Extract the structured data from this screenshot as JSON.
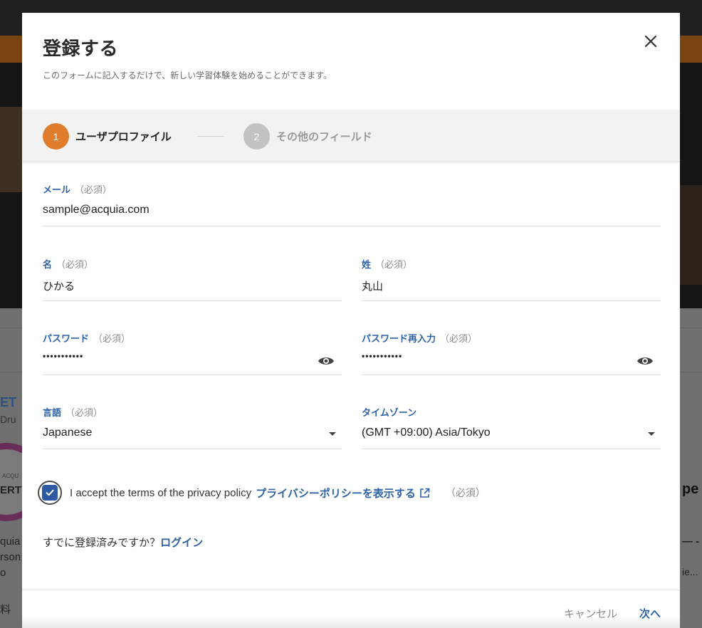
{
  "background": {
    "left_snippets": [
      "ET",
      "Dru",
      "ACQU",
      "ERTI",
      "quia",
      "rson",
      "o",
      "料"
    ],
    "right_snippets": [
      "pe",
      "— -",
      "ie..."
    ]
  },
  "modal": {
    "title": "登録する",
    "subtitle": "このフォームに記入するだけで、新しい学習体験を始めることができます。",
    "close_icon": "close-icon"
  },
  "steps": [
    {
      "number": "1",
      "label": "ユーザプロファイル",
      "state": "active",
      "color": "#e07d2d"
    },
    {
      "number": "2",
      "label": "その他のフィールド",
      "state": "inactive",
      "color": "#c2c2c2"
    }
  ],
  "fields": {
    "email": {
      "label": "メール",
      "required": "（必須）",
      "value": "sample@acquia.com"
    },
    "first_name": {
      "label": "名",
      "required": "（必須）",
      "value": "ひかる"
    },
    "last_name": {
      "label": "姓",
      "required": "（必須）",
      "value": "丸山"
    },
    "password": {
      "label": "パスワード",
      "required": "（必須）",
      "value": "•••••••••••",
      "icon": "eye-icon"
    },
    "password_confirm": {
      "label": "パスワード再入力",
      "required": "（必須）",
      "value": "•••••••••••",
      "icon": "eye-icon"
    },
    "language": {
      "label": "言語",
      "required": "（必須）",
      "value": "Japanese",
      "icon": "caret-down-icon"
    },
    "timezone": {
      "label": "タイムゾーン",
      "value": "(GMT +09:00) Asia/Tokyo",
      "icon": "caret-down-icon"
    }
  },
  "consent": {
    "checked": true,
    "text": "I accept the terms of the privacy policy",
    "link": "プライバシーポリシーを表示する",
    "link_icon": "external-link-icon",
    "required": "（必須）"
  },
  "login": {
    "prompt": "すでに登録済みですか？",
    "link": "ログイン"
  },
  "footer": {
    "cancel": "キャンセル",
    "next": "次へ"
  },
  "colors": {
    "accent": "#2d62a8",
    "step_active": "#e07d2d",
    "checkbox": "#2d5aa3"
  }
}
